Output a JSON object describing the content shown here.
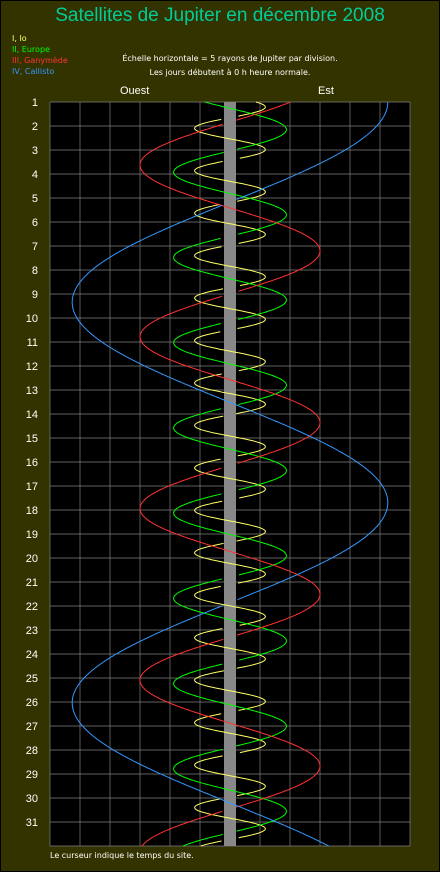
{
  "title": "Satellites de Jupiter en décembre 2008",
  "legend": [
    {
      "label": "I, Io",
      "color": "#ffff66"
    },
    {
      "label": "II, Europe",
      "color": "#00ff00"
    },
    {
      "label": "III, Ganymède",
      "color": "#ff3333"
    },
    {
      "label": "IV, Callisto",
      "color": "#3399ff"
    }
  ],
  "note_line1": "Échelle horizontale = 5 rayons de Jupiter par division.",
  "note_line2": "Les jours débutent à 0 h heure normale.",
  "west_label": "Ouest",
  "east_label": "Est",
  "footer": "Le curseur indique le temps du site.",
  "chart_data": {
    "type": "line",
    "title": "Satellites de Jupiter en décembre 2008",
    "x_unit": "jupiter radii",
    "x_range": [
      -30,
      30
    ],
    "x_division": 5,
    "y_range": [
      1,
      32
    ],
    "y_ticks": [
      1,
      2,
      3,
      4,
      5,
      6,
      7,
      8,
      9,
      10,
      11,
      12,
      13,
      14,
      15,
      16,
      17,
      18,
      19,
      20,
      21,
      22,
      23,
      24,
      25,
      26,
      27,
      28,
      29,
      30,
      31
    ],
    "grid": true,
    "planet_band": {
      "color": "#888888"
    },
    "series": [
      {
        "name": "I, Io",
        "color": "#ffff66",
        "amplitude": 5.9,
        "period_days": 1.769,
        "phase_day": 1.21,
        "dash_on": 0.36
      },
      {
        "name": "II, Europe",
        "color": "#00ff00",
        "amplitude": 9.4,
        "period_days": 3.551,
        "phase_day": 2.15
      },
      {
        "name": "III, Ganymède",
        "color": "#ff3333",
        "amplitude": 15.0,
        "period_days": 7.155,
        "phase_day": 0.05
      },
      {
        "name": "IV, Callisto",
        "color": "#3399ff",
        "amplitude": 26.3,
        "period_days": 16.689,
        "phase_day": 1.0
      }
    ]
  }
}
